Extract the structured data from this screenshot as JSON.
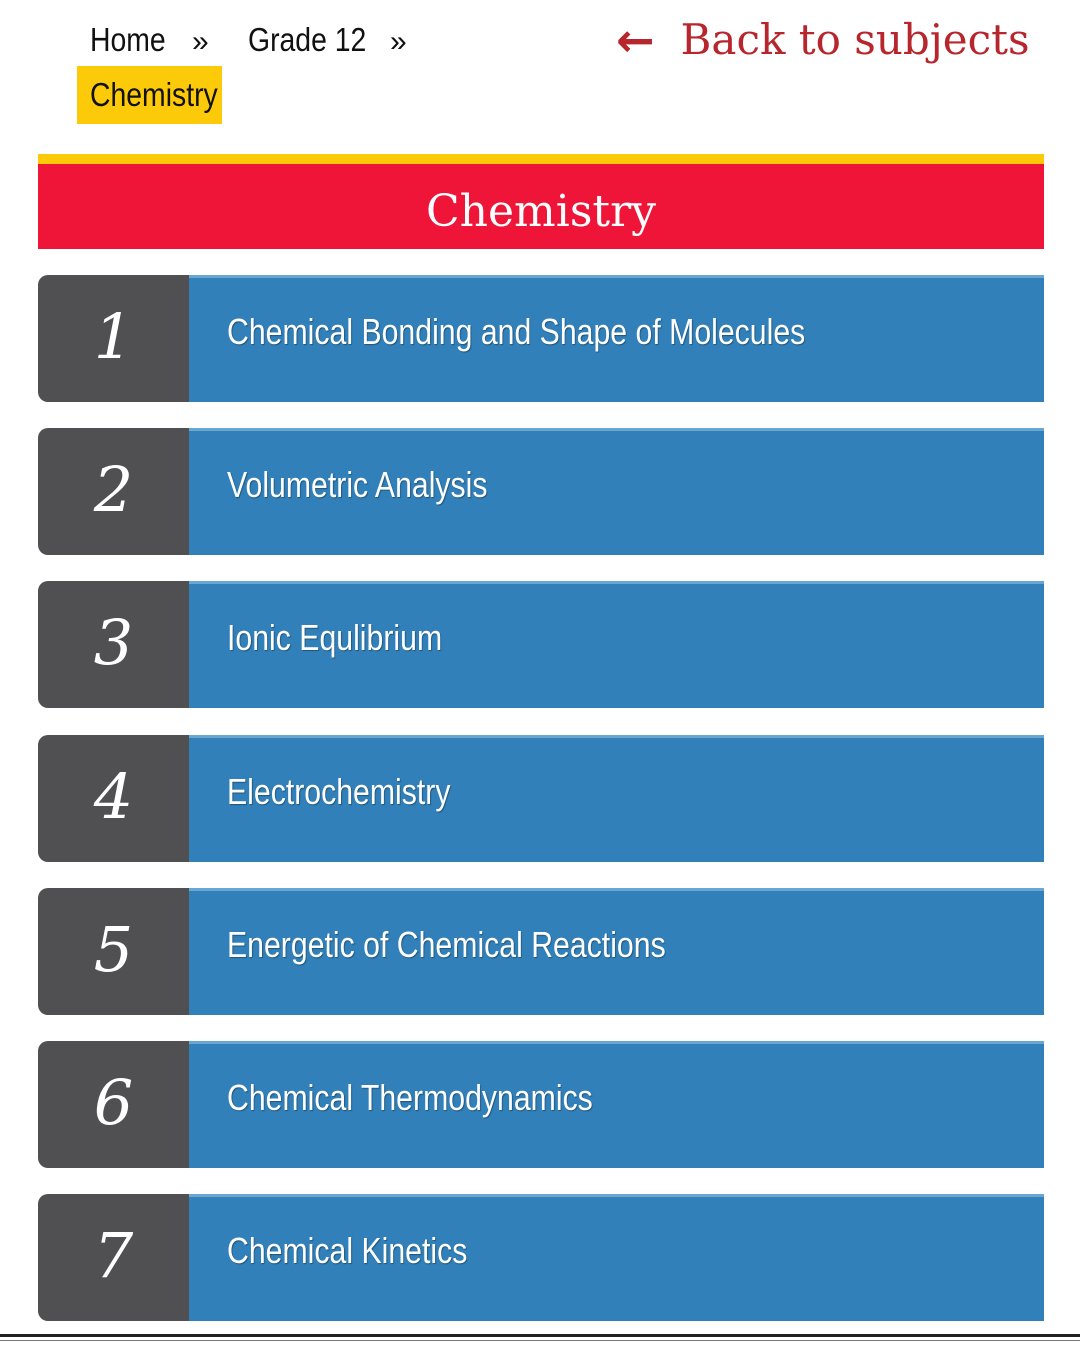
{
  "breadcrumb": {
    "home": "Home",
    "separator": "»",
    "grade": "Grade 12",
    "current": "Chemistry"
  },
  "back_link": {
    "arrow": "←",
    "label": "Back to subjects"
  },
  "page_title": "Chemistry",
  "chapters": [
    {
      "number": "1",
      "title": "Chemical Bonding and Shape of Molecules"
    },
    {
      "number": "2",
      "title": "Volumetric Analysis"
    },
    {
      "number": "3",
      "title": "Ionic Equlibrium"
    },
    {
      "number": "4",
      "title": "Electrochemistry"
    },
    {
      "number": "5",
      "title": "Energetic of Chemical Reactions"
    },
    {
      "number": "6",
      "title": "Chemical Thermodynamics"
    },
    {
      "number": "7",
      "title": "Chemical Kinetics"
    }
  ],
  "colors": {
    "accent_yellow": "#fdca09",
    "title_red": "#ee1539",
    "chapter_blue": "#3180b9",
    "number_gray": "#505052",
    "back_link_red": "#b8262d"
  }
}
